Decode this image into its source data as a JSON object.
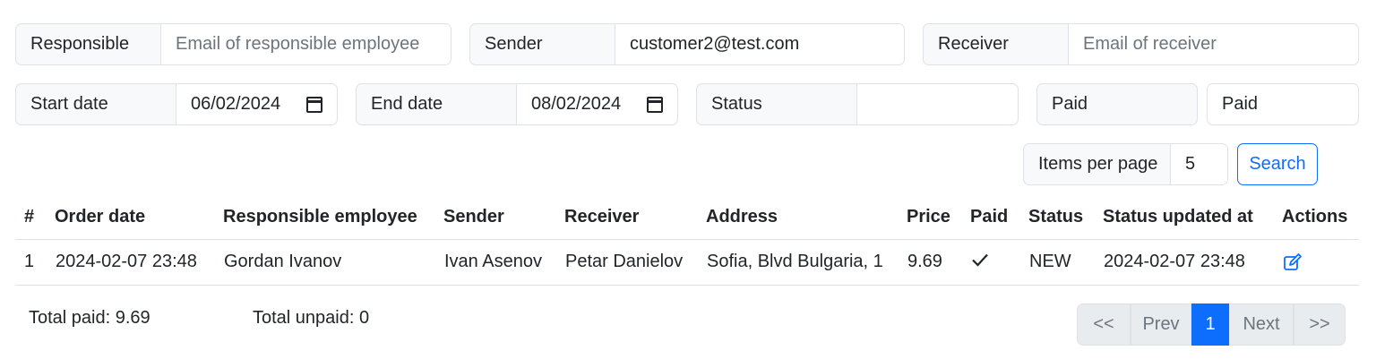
{
  "filters": {
    "responsible_label": "Responsible",
    "responsible_placeholder": "Email of responsible employee",
    "sender_label": "Sender",
    "sender_value": "customer2@test.com",
    "receiver_label": "Receiver",
    "receiver_placeholder": "Email of receiver",
    "start_date_label": "Start date",
    "start_date_value": "06/02/2024",
    "end_date_label": "End date",
    "end_date_value": "08/02/2024",
    "status_label": "Status",
    "status_value": "",
    "paid_label": "Paid",
    "paid_value": "Paid",
    "items_per_page_label": "Items per page",
    "items_per_page_value": "5",
    "search_label": "Search"
  },
  "table": {
    "headers": [
      "#",
      "Order date",
      "Responsible employee",
      "Sender",
      "Receiver",
      "Address",
      "Price",
      "Paid",
      "Status",
      "Status updated at",
      "Actions"
    ],
    "rows": [
      {
        "index": "1",
        "order_date": "2024-02-07 23:48",
        "responsible": "Gordan Ivanov",
        "sender": "Ivan Asenov",
        "receiver": "Petar Danielov",
        "address": "Sofia, Blvd Bulgaria, 1",
        "price": "9.69",
        "paid_icon": "checkmark-icon",
        "status": "NEW",
        "status_updated_at": "2024-02-07 23:48",
        "action_icon": "edit-icon"
      }
    ]
  },
  "totals": {
    "paid": "Total paid: 9.69",
    "unpaid": "Total unpaid: 0"
  },
  "pagination": {
    "first": "<<",
    "prev": "Prev",
    "current": "1",
    "next": "Next",
    "last": ">>"
  },
  "colors": {
    "accent": "#0d6efd",
    "border": "#dee2e6",
    "addon_bg": "#f8f9fa"
  }
}
